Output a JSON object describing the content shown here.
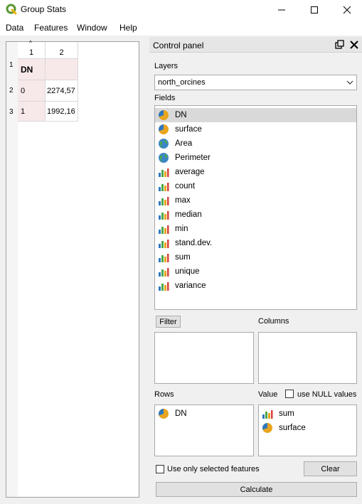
{
  "window": {
    "title": "Group Stats",
    "minimize_icon": "minimize-icon",
    "maximize_icon": "maximize-icon",
    "close_icon": "close-icon"
  },
  "menu": [
    "Data",
    "Features",
    "Window",
    "Help"
  ],
  "table": {
    "column_headers": [
      "1",
      "2"
    ],
    "row_headers": [
      "1",
      "2",
      "3"
    ],
    "rows": [
      [
        "DN",
        ""
      ],
      [
        "0",
        "2274,57"
      ],
      [
        "1",
        "1992,16"
      ]
    ]
  },
  "panel": {
    "title": "Control panel",
    "layers_label": "Layers",
    "layer_selected": "north_orcines",
    "fields_label": "Fields",
    "fields": [
      {
        "label": "DN",
        "icon": "pie-icon"
      },
      {
        "label": "surface",
        "icon": "pie-icon"
      },
      {
        "label": "Area",
        "icon": "globe-icon"
      },
      {
        "label": "Perimeter",
        "icon": "globe-icon"
      },
      {
        "label": "average",
        "icon": "bar-chart-icon"
      },
      {
        "label": "count",
        "icon": "bar-chart-icon"
      },
      {
        "label": "max",
        "icon": "bar-chart-icon"
      },
      {
        "label": "median",
        "icon": "bar-chart-icon"
      },
      {
        "label": "min",
        "icon": "bar-chart-icon"
      },
      {
        "label": "stand.dev.",
        "icon": "bar-chart-icon"
      },
      {
        "label": "sum",
        "icon": "bar-chart-icon"
      },
      {
        "label": "unique",
        "icon": "bar-chart-icon"
      },
      {
        "label": "variance",
        "icon": "bar-chart-icon"
      }
    ],
    "filter_button": "Filter",
    "columns_label": "Columns",
    "rows_label": "Rows",
    "rows_items": [
      {
        "label": "DN",
        "icon": "pie-icon"
      }
    ],
    "value_label": "Value",
    "use_null_label": "use NULL values",
    "value_items": [
      {
        "label": "sum",
        "icon": "bar-chart-icon"
      },
      {
        "label": "surface",
        "icon": "pie-icon"
      }
    ],
    "use_selected_label": "Use only selected features",
    "clear_button": "Clear",
    "calculate_button": "Calculate"
  }
}
